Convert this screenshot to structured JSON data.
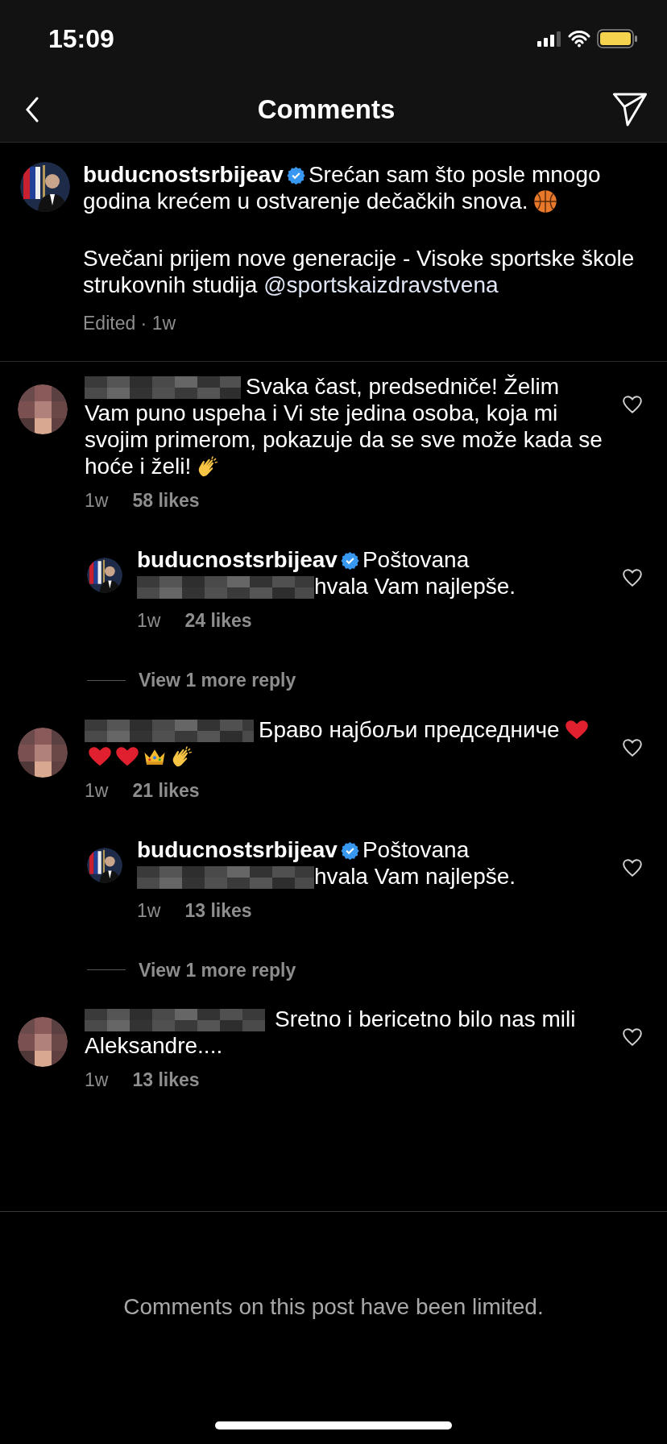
{
  "status_bar": {
    "time": "15:09"
  },
  "header": {
    "title": "Comments"
  },
  "post": {
    "username": "buducnostsrbijeav",
    "verified": true,
    "paragraphs": [
      {
        "text": "Srećan sam što posle mnogo godina krećem u ostvarenje dečačkih snova.",
        "icons": [
          {
            "kind": "basketball"
          }
        ]
      },
      {
        "text": "Svečani prijem nove generacije - Visoke sportske škole strukovnih studija",
        "mention": "@sportskaizdravstvena"
      }
    ],
    "meta": "Edited · 1w"
  },
  "items": [
    {
      "kind": "comment",
      "username_hidden": true,
      "parts": [
        {
          "kind": "text",
          "text": "Svaka čast, predsedniče! Želim Vam puno uspeha i Vi ste jedina osoba, koja mi svojim primerom, pokazuje da se sve može kada se hoće i želi!"
        }
      ],
      "icons": [
        {
          "kind": "clap"
        }
      ],
      "time": "1w",
      "likes": "58 likes",
      "liked": false
    },
    {
      "kind": "reply",
      "username": "buducnostsrbijeav",
      "verified": true,
      "parts": [
        {
          "kind": "text",
          "text": "Poštovana"
        },
        {
          "kind": "hidden"
        },
        {
          "kind": "text",
          "text": "hvala Vam najlepše."
        }
      ],
      "time": "1w",
      "likes": "24 likes",
      "liked": false
    },
    {
      "kind": "more",
      "text": "View 1 more reply"
    },
    {
      "kind": "comment",
      "username_hidden": true,
      "parts": [
        {
          "kind": "text",
          "text": "Браво најбољи председниче"
        }
      ],
      "icons": [
        {
          "kind": "heart"
        },
        {
          "kind": "heart"
        },
        {
          "kind": "heart"
        },
        {
          "kind": "crown"
        },
        {
          "kind": "clap"
        }
      ],
      "time": "1w",
      "likes": "21 likes",
      "liked": false
    },
    {
      "kind": "reply",
      "username": "buducnostsrbijeav",
      "verified": true,
      "parts": [
        {
          "kind": "text",
          "text": "Poštovana"
        },
        {
          "kind": "hidden"
        },
        {
          "kind": "text",
          "text": "hvala Vam najlepše."
        }
      ],
      "time": "1w",
      "likes": "13 likes",
      "liked": false
    },
    {
      "kind": "more",
      "text": "View 1 more reply"
    },
    {
      "kind": "comment",
      "username_hidden": true,
      "parts": [
        {
          "kind": "text",
          "text": "Sretno i bericetno bilo nas mili Aleksandre...."
        }
      ],
      "time": "1w",
      "likes": "13 likes",
      "liked": false
    }
  ],
  "footer": {
    "notice": "Comments on this post have been limited."
  }
}
